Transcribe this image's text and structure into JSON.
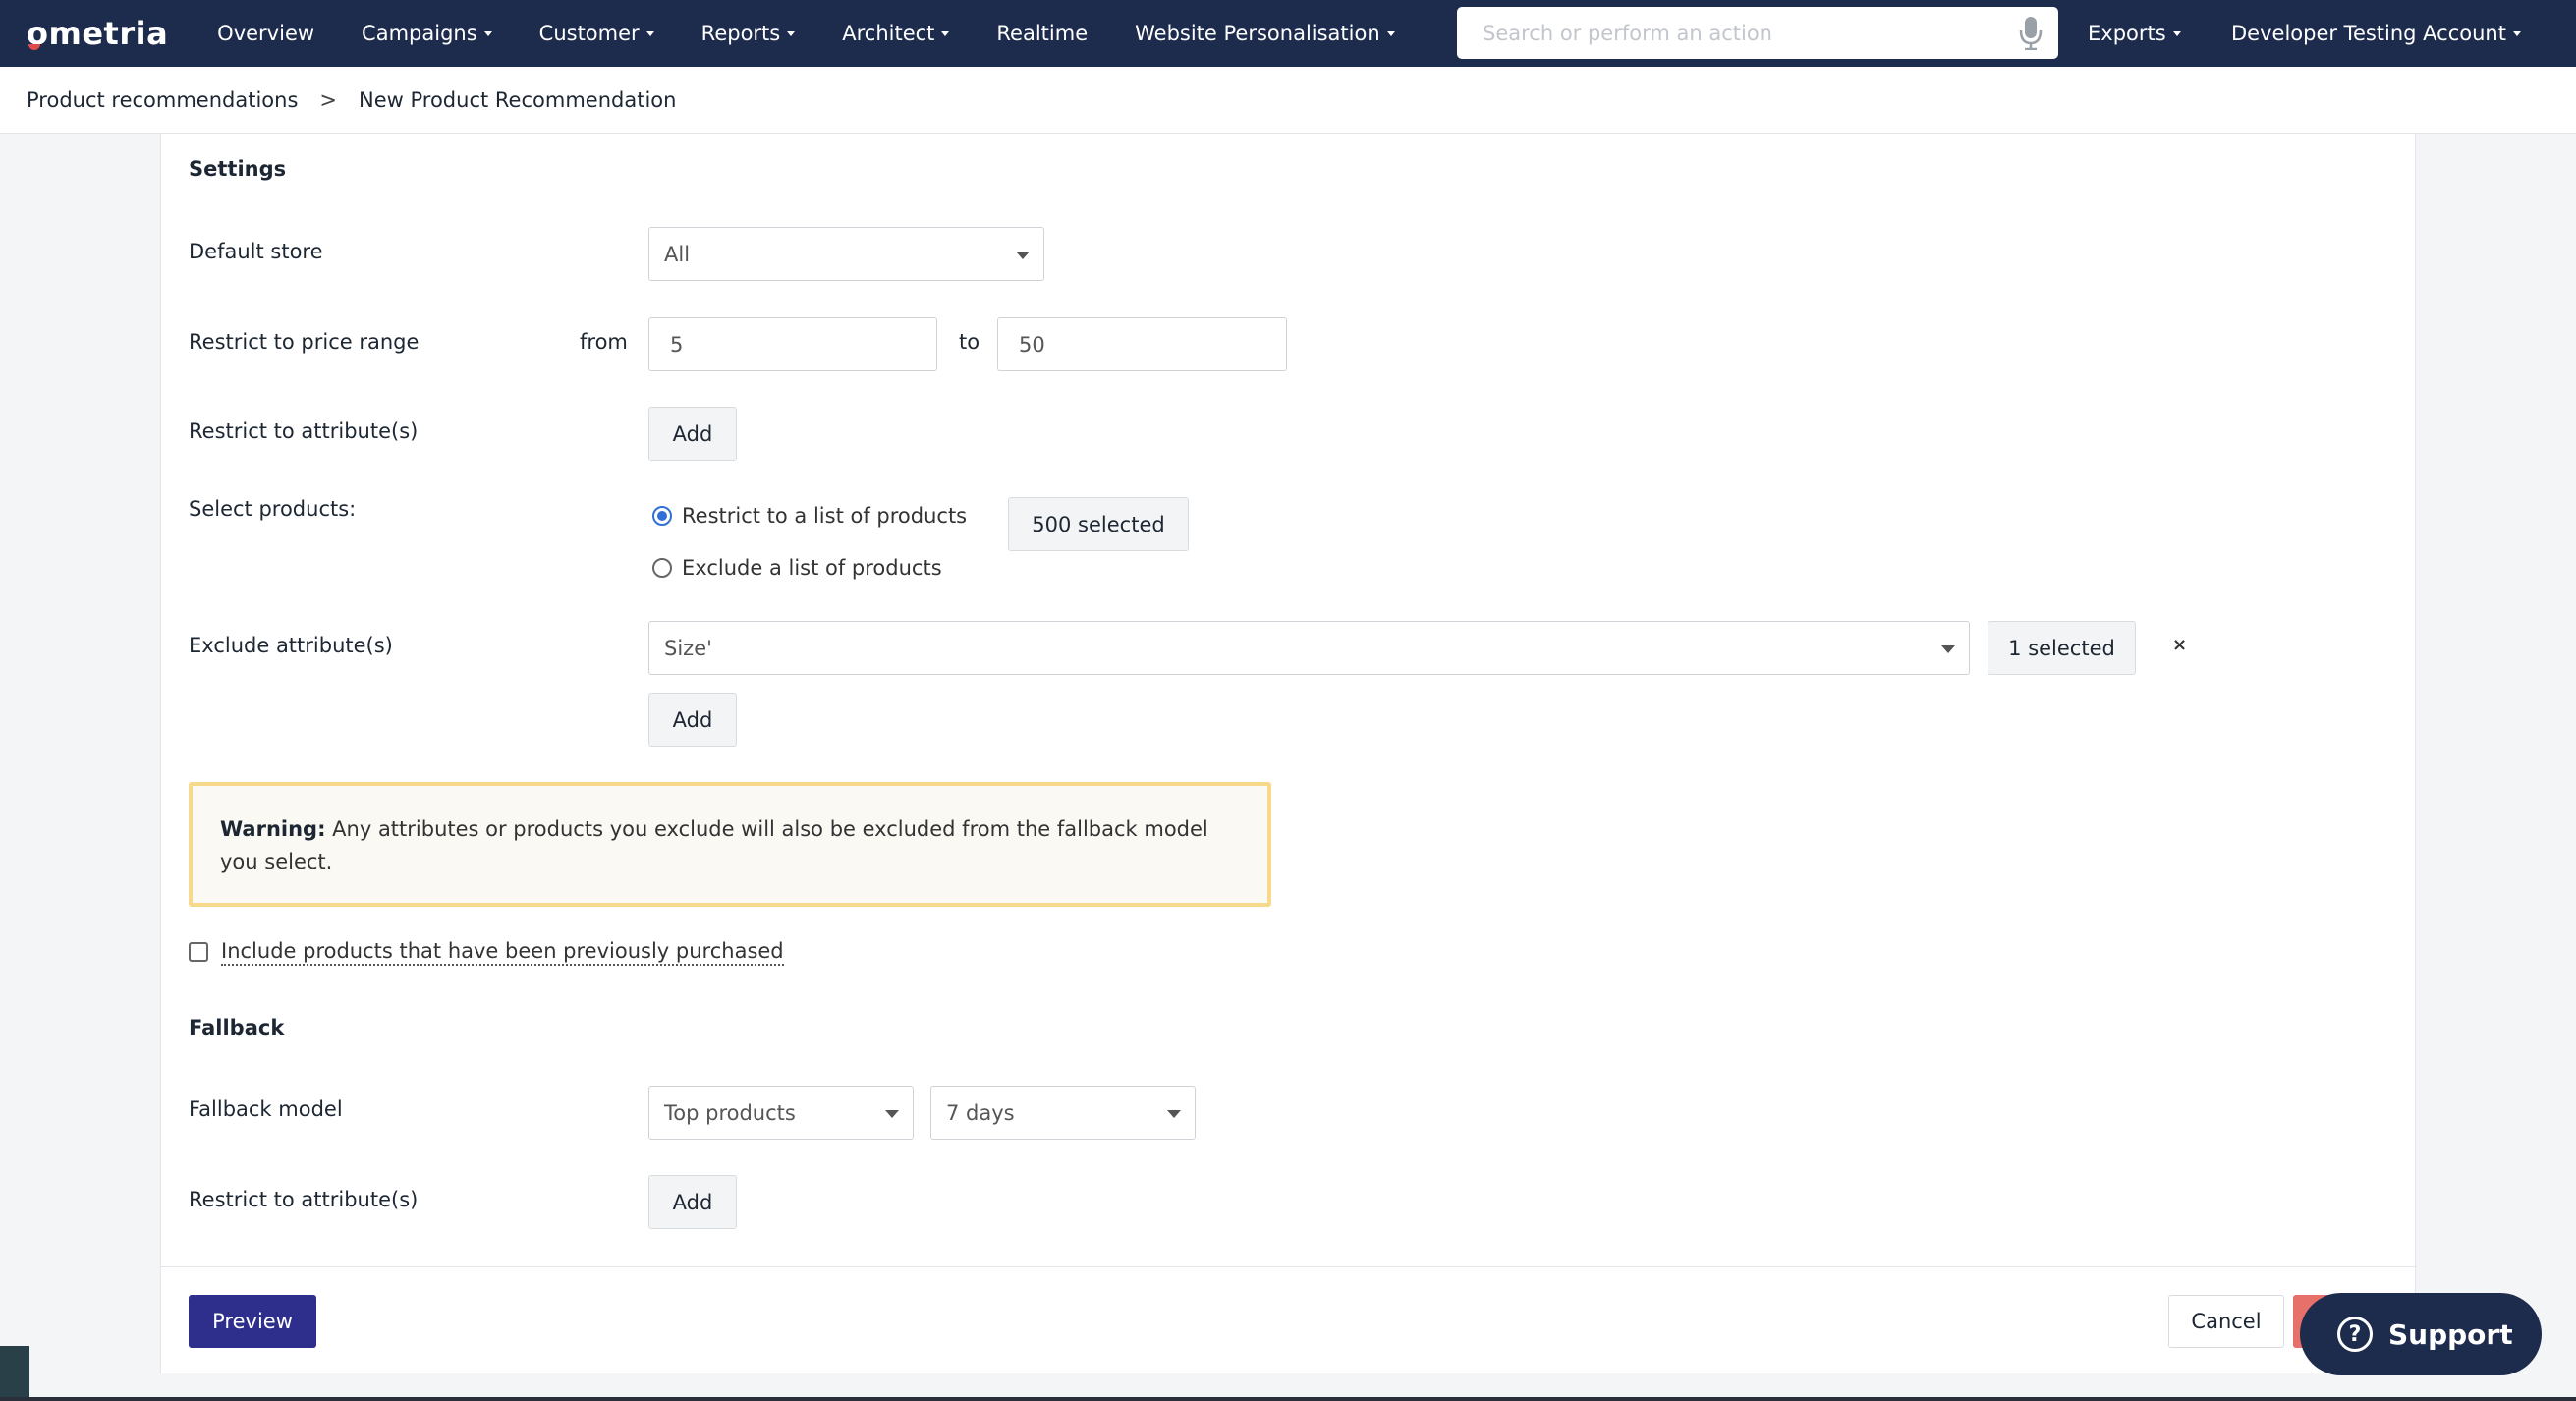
{
  "navbar": {
    "logo": "ometria",
    "items": [
      {
        "label": "Overview",
        "caret": false
      },
      {
        "label": "Campaigns",
        "caret": true
      },
      {
        "label": "Customer",
        "caret": true
      },
      {
        "label": "Reports",
        "caret": true
      },
      {
        "label": "Architect",
        "caret": true
      },
      {
        "label": "Realtime",
        "caret": false
      },
      {
        "label": "Website Personalisation",
        "caret": true
      }
    ],
    "search_placeholder": "Search or perform an action",
    "exports_label": "Exports",
    "account_label": "Developer Testing Account"
  },
  "breadcrumb": {
    "parent": "Product recommendations",
    "separator": ">",
    "current": "New Product Recommendation"
  },
  "settings": {
    "title": "Settings",
    "default_store_label": "Default store",
    "default_store_value": "All",
    "price_range_label": "Restrict to price range",
    "from_label": "from",
    "from_value": "5",
    "to_label": "to",
    "to_value": "50",
    "restrict_attr_label": "Restrict to attribute(s)",
    "add_label": "Add",
    "select_products_label": "Select products:",
    "radio_restrict": "Restrict to a list of products",
    "radio_exclude": "Exclude a list of products",
    "selected_count": "500 selected",
    "exclude_attr_label": "Exclude attribute(s)",
    "exclude_attr_value": "Size'",
    "exclude_selected": "1 selected",
    "remove_symbol": "×",
    "warning_bold": "Warning:",
    "warning_text": " Any attributes or products you exclude will also be excluded from the fallback model you select.",
    "include_purchased": "Include products that have been previously purchased"
  },
  "fallback": {
    "title": "Fallback",
    "model_label": "Fallback model",
    "model_value": "Top products",
    "period_value": "7 days",
    "restrict_attr_label": "Restrict to attribute(s)",
    "add_label": "Add"
  },
  "footer": {
    "preview_label": "Preview",
    "cancel_label": "Cancel"
  },
  "support": {
    "label": "Support",
    "icon_glyph": "?"
  }
}
